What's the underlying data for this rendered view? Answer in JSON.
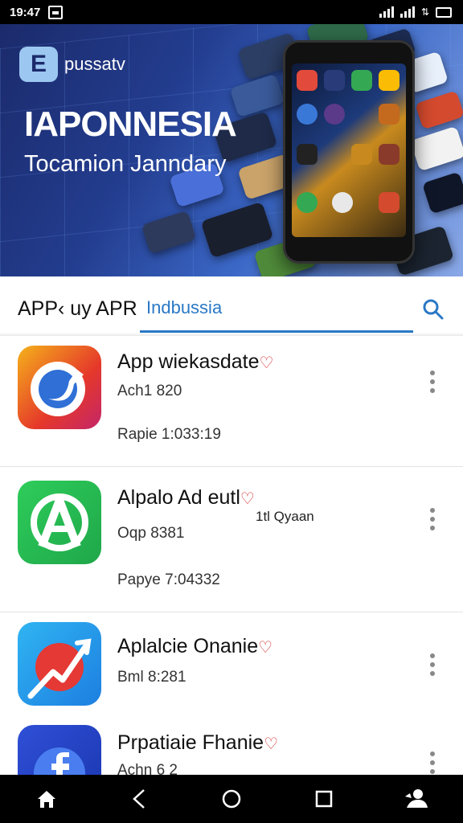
{
  "status_bar": {
    "time": "19:47"
  },
  "banner": {
    "logo_letter": "E",
    "logo_name": "pussatv",
    "title": "IAPONNESIA",
    "subtitle": "Tocamion Janndary"
  },
  "search_bar": {
    "label": "APP‹ uy APR",
    "query": "Indbussia"
  },
  "apps": [
    {
      "title": "App wiekasdate",
      "sub": "Ach1 820",
      "meta": "Rapie 1:033:19",
      "extra": ""
    },
    {
      "title": "Alpalo Ad eutl",
      "sub": "Oqp 8381",
      "meta": "Papye 7:04332",
      "extra": "1tl Qyaan"
    },
    {
      "title": "Aplalcie Onanie",
      "sub": "Bml 8:281",
      "meta": "",
      "extra": ""
    },
    {
      "title": "Prpatiaie Fhanie",
      "sub": "Achn 6 2",
      "meta": "",
      "extra": ""
    }
  ],
  "colors": {
    "accent": "#2a78c5",
    "heart": "#d32f2f",
    "banner_dark": "#1b2a6b"
  }
}
